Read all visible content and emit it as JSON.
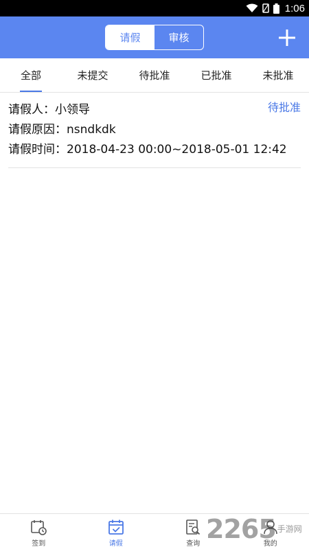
{
  "status_bar": {
    "time": "1:06",
    "icons": [
      "wifi-icon",
      "no-sim-icon",
      "battery-icon"
    ]
  },
  "header": {
    "segments": [
      {
        "label": "请假",
        "active": true
      },
      {
        "label": "审核",
        "active": false
      }
    ],
    "add_icon": "plus-icon",
    "color": "#5b86f0"
  },
  "tabs": [
    {
      "label": "全部",
      "selected": true
    },
    {
      "label": "未提交",
      "selected": false
    },
    {
      "label": "待批准",
      "selected": false
    },
    {
      "label": "已批准",
      "selected": false
    },
    {
      "label": "未批准",
      "selected": false
    }
  ],
  "leave_items": [
    {
      "applicant": "请假人：小领导",
      "reason": "请假原因：nsndkdk",
      "time": "请假时间：2018-04-23 00:00~2018-05-01 12:42",
      "status": "待批准"
    }
  ],
  "bottom_nav": [
    {
      "label": "签到",
      "icon": "calendar-clock-icon",
      "active": false
    },
    {
      "label": "请假",
      "icon": "calendar-check-icon",
      "active": true
    },
    {
      "label": "查询",
      "icon": "document-search-icon",
      "active": false
    },
    {
      "label": "我的",
      "icon": "user-icon",
      "active": false
    }
  ],
  "watermark": {
    "number": "2265",
    "text": "手游网"
  },
  "colors": {
    "accent": "#4a78e6",
    "header": "#5b86f0",
    "divider": "#e2e2e2"
  }
}
